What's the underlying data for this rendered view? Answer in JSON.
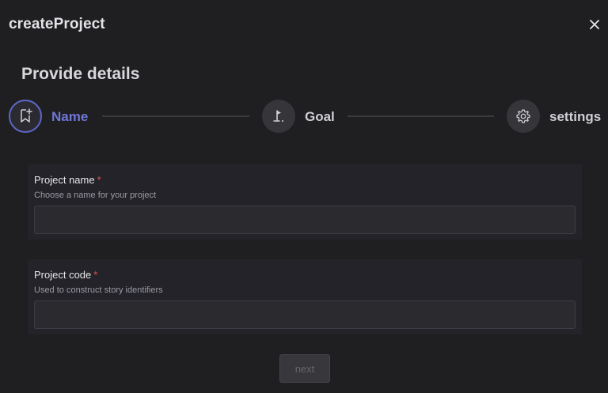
{
  "header": {
    "title": "createProject",
    "close_icon": "close-icon"
  },
  "section": {
    "title": "Provide details"
  },
  "stepper": {
    "steps": [
      {
        "label": "Name",
        "icon": "bookmark-add-icon",
        "active": true
      },
      {
        "label": "Goal",
        "icon": "flag-icon",
        "active": false
      },
      {
        "label": "settings",
        "icon": "gear-icon",
        "active": false
      }
    ],
    "accent_color": "#5e66c7"
  },
  "form": {
    "project_name": {
      "label": "Project name",
      "required_mark": "*",
      "help": "Choose a name for your project",
      "value": "",
      "placeholder": ""
    },
    "project_code": {
      "label": "Project code",
      "required_mark": "*",
      "help": "Used to construct story identifiers",
      "value": "",
      "placeholder": ""
    }
  },
  "actions": {
    "next_label": "next",
    "next_disabled": true
  }
}
